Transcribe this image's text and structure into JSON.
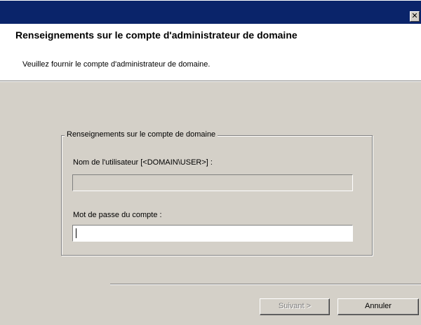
{
  "window": {
    "title": "",
    "close_glyph": "✕",
    "close_icon": "close-icon"
  },
  "header": {
    "title": "Renseignements sur le compte d'administrateur de domaine",
    "description": "Veuillez fournir le compte d'administrateur de domaine."
  },
  "account_group": {
    "legend": "Renseignements sur le compte de domaine",
    "username_label": "Nom de l'utilisateur [<DOMAIN\\USER>] :",
    "username_value": "",
    "password_label": "Mot de passe du compte :",
    "password_value": ""
  },
  "buttons": {
    "next_label": "Suivant >",
    "cancel_label": "Annuler"
  },
  "colors": {
    "titlebar": "#0a246a",
    "dialog_bg": "#d4d0c8",
    "header_bg": "#ffffff"
  }
}
